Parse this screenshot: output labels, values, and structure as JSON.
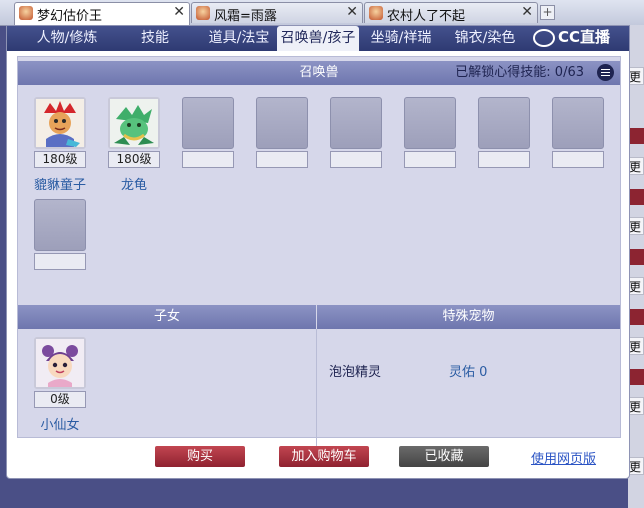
{
  "browser": {
    "tabs": [
      {
        "label": "梦幻估价王",
        "active": true
      },
      {
        "label": "风霜=雨露",
        "active": false
      },
      {
        "label": "农村人了不起",
        "active": false
      }
    ],
    "new_tab": "+"
  },
  "nav": {
    "items": [
      "人物/修炼",
      "技能",
      "道具/法宝",
      "召唤兽/孩子",
      "坐骑/祥瑞",
      "锦衣/染色"
    ],
    "active_index": 3
  },
  "watermark": "CC直播",
  "summons": {
    "title": "召唤兽",
    "skill_unlock_label": "已解锁心得技能:",
    "skill_unlock_count": "0/63",
    "pets": [
      {
        "level": "180级",
        "name": "貔貅童子",
        "icon": "demon-boy-portrait-icon"
      },
      {
        "level": "180级",
        "name": "龙龟",
        "icon": "dragon-turtle-portrait-icon"
      }
    ]
  },
  "children": {
    "title": "子女",
    "items": [
      {
        "level": "0级",
        "name": "小仙女",
        "icon": "fairy-girl-portrait-icon"
      }
    ]
  },
  "special_pets": {
    "title": "特殊宠物",
    "name": "泡泡精灵",
    "bless": "灵佑 0"
  },
  "actions": {
    "buy": "购买",
    "add_cart": "加入购物车",
    "favorited": "已收藏",
    "web_version": "使用网页版"
  },
  "background_page": {
    "labels": [
      "更",
      "更",
      "更",
      "更",
      "更",
      "更",
      "更",
      "更",
      "更"
    ]
  },
  "colors": {
    "nav_bg": "#2e3a72",
    "section_header": "#7a81b8",
    "red_button": "#a8323f",
    "gray_button": "#555555",
    "link": "#2b54c4",
    "pet_name": "#2b5ca3"
  }
}
